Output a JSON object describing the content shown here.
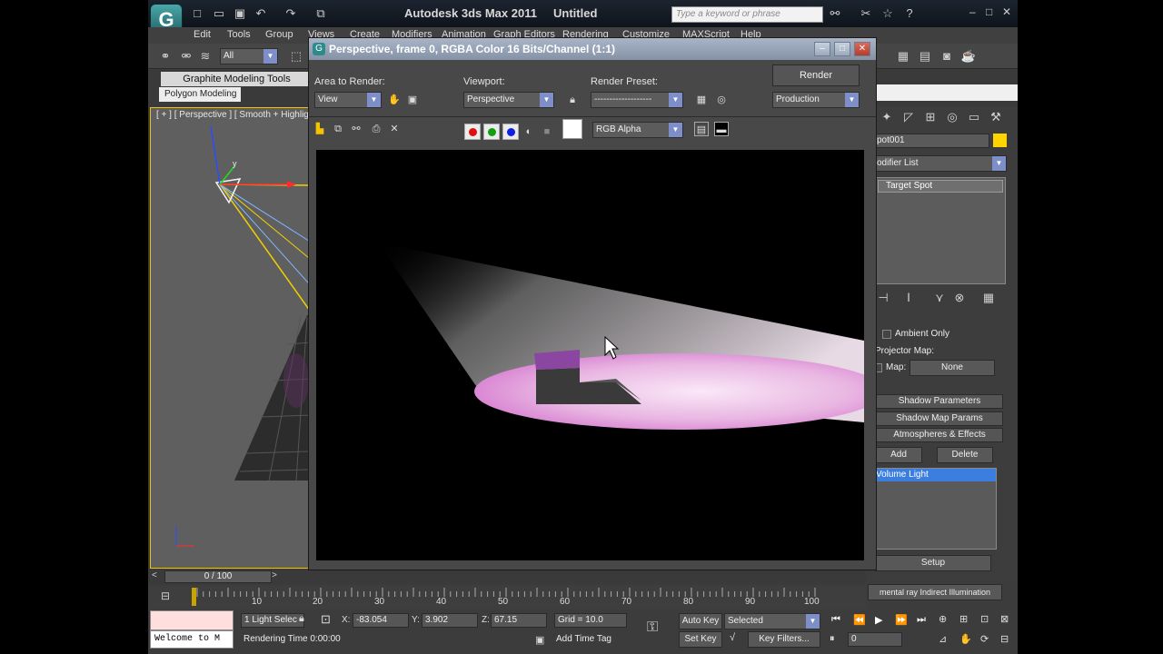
{
  "titlebar": {
    "app": "Autodesk 3ds Max 2011",
    "doc": "Untitled",
    "search_placeholder": "Type a keyword or phrase"
  },
  "menu": [
    "Edit",
    "Tools",
    "Group",
    "Views",
    "Create",
    "Modifiers",
    "Animation",
    "Graph Editors",
    "Rendering",
    "Customize",
    "MAXScript",
    "Help"
  ],
  "toolbar": {
    "selection_filter": "All"
  },
  "ribbon": {
    "tab": "Graphite Modeling Tools",
    "subtab": "Polygon Modeling"
  },
  "viewport": {
    "label": "[ + ] [ Perspective ] [ Smooth + Highlig"
  },
  "render_window": {
    "title": "Perspective, frame 0, RGBA Color 16 Bits/Channel (1:1)",
    "area_label": "Area to Render:",
    "area_value": "View",
    "viewport_label": "Viewport:",
    "viewport_value": "Perspective",
    "preset_label": "Render Preset:",
    "preset_value": "-------------------",
    "render_button": "Render",
    "mode_value": "Production",
    "channel_value": "RGB Alpha"
  },
  "command_panel": {
    "object_name": "pot001",
    "modifier_list": "odifier List",
    "stack_item": "Target Spot",
    "ambient_only": "Ambient Only",
    "projector_map": "Projector Map:",
    "map_label": "Map:",
    "map_value": "None",
    "rollouts": [
      "Shadow Parameters",
      "Shadow Map Params",
      "Atmospheres & Effects"
    ],
    "add": "Add",
    "delete": "Delete",
    "effect_item": "Volume Light",
    "setup": "Setup",
    "mr_indirect": "mental ray Indirect Illumination"
  },
  "timeline": {
    "frame": "0 / 100",
    "ticks": [
      "10",
      "20",
      "30",
      "40",
      "50",
      "60",
      "70",
      "80",
      "90",
      "100"
    ]
  },
  "status": {
    "welcome": "Welcome to M",
    "selection": "1 Light Selec",
    "x_label": "X:",
    "x": "-83.054",
    "y_label": "Y:",
    "y": "3.902",
    "z_label": "Z:",
    "z": "67.15",
    "grid": "Grid = 10.0",
    "rendering_time": "Rendering Time  0:00:00",
    "add_time_tag": "Add Time Tag",
    "auto_key": "Auto Key",
    "set_key": "Set Key",
    "selected": "Selected",
    "key_filters": "Key Filters...",
    "frame_field": "0"
  },
  "colors": {
    "selection_yellow": "#f4c400",
    "volume_light_pink": "#e9a6e0"
  }
}
